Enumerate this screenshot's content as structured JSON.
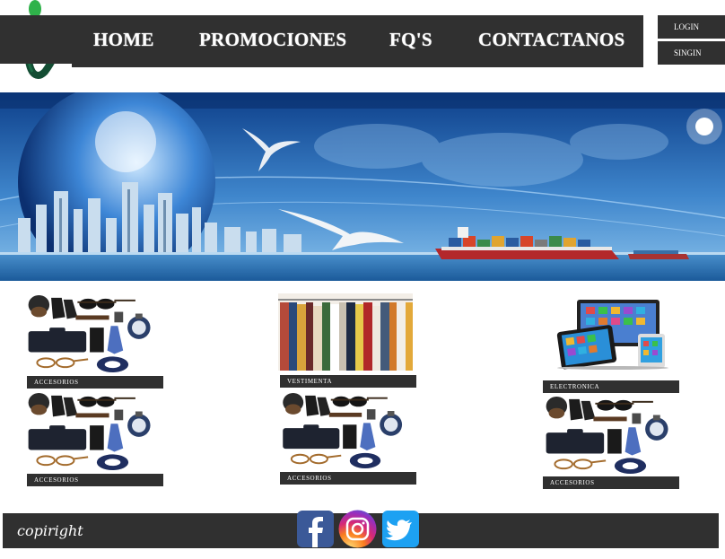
{
  "nav": {
    "home_label": "HOME",
    "promo_label": "PROMOCIONES",
    "faq_label": "FQ'S",
    "contact_label": "CONTACTANOS"
  },
  "auth": {
    "login_label": "LOGIN",
    "signin_label": "SINGIN"
  },
  "products": [
    {
      "label": "ACCESORIOS",
      "image": "accessories"
    },
    {
      "label": "VESTIMENTA",
      "image": "clothing-rack"
    },
    {
      "label": "ELECTRONICA",
      "image": "tablets"
    },
    {
      "label": "ACCESORIOS",
      "image": "accessories"
    },
    {
      "label": "ACCESORIOS",
      "image": "accessories"
    },
    {
      "label": "ACCESORIOS",
      "image": "accessories"
    }
  ],
  "footer": {
    "copyright_text": "copiright"
  },
  "social": [
    "facebook-icon",
    "instagram-icon",
    "twitter-icon"
  ],
  "colors": {
    "bar": "#303030",
    "logo_green": "#1a5c3a",
    "facebook": "#3b5998",
    "twitter": "#1da1f2"
  }
}
